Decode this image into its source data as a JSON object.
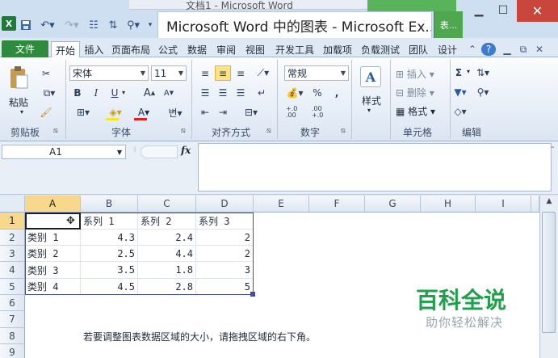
{
  "window": {
    "background_doc_title": "文档1 - Microsoft Word",
    "app_title": "Microsoft Word 中的图表 - Microsoft Ex...",
    "context_tab": "表...",
    "excel_logo": "X"
  },
  "ribbon_tabs": [
    "文件",
    "开始",
    "插入",
    "页面布局",
    "公式",
    "数据",
    "审阅",
    "视图",
    "开发工具",
    "加载项",
    "负载测试",
    "团队",
    "设计"
  ],
  "active_tab": "开始",
  "clipboard": {
    "paste": "粘贴",
    "label": "剪贴板"
  },
  "font": {
    "family": "宋体",
    "size": "11",
    "bold": "B",
    "italic": "I",
    "underline": "U",
    "grow": "A",
    "shrink": "A",
    "label": "字体"
  },
  "alignment": {
    "label": "对齐方式"
  },
  "number": {
    "format": "常规",
    "percent": "%",
    "comma": ",",
    "inc_dec": "+.0 .00",
    "dec_dec": ".00 +.0",
    "label": "数字"
  },
  "styles": {
    "label": "样式"
  },
  "cells": {
    "insert": "插入",
    "delete": "删除",
    "format": "格式",
    "label": "单元格"
  },
  "editing": {
    "sum": "Σ",
    "label": "编辑"
  },
  "formula_bar": {
    "name_box": "A1",
    "fx": "fx",
    "formula": ""
  },
  "sheet": {
    "columns": [
      "A",
      "B",
      "C",
      "D",
      "E",
      "F",
      "G",
      "H",
      "I"
    ],
    "rows": [
      "1",
      "2",
      "3",
      "4",
      "5",
      "6",
      "7",
      "8",
      "9"
    ],
    "header_row": [
      "",
      "系列 1",
      "系列 2",
      "系列 3"
    ],
    "data": [
      [
        "类别 1",
        "4.3",
        "2.4",
        "2"
      ],
      [
        "类别 2",
        "2.5",
        "4.4",
        "2"
      ],
      [
        "类别 3",
        "3.5",
        "1.8",
        "3"
      ],
      [
        "类别 4",
        "4.5",
        "2.8",
        "5"
      ]
    ],
    "note": "若要调整图表数据区域的大小，请拖拽区域的右下角。"
  },
  "watermark": {
    "title": "百科全说",
    "subtitle": "助你轻松解决"
  }
}
